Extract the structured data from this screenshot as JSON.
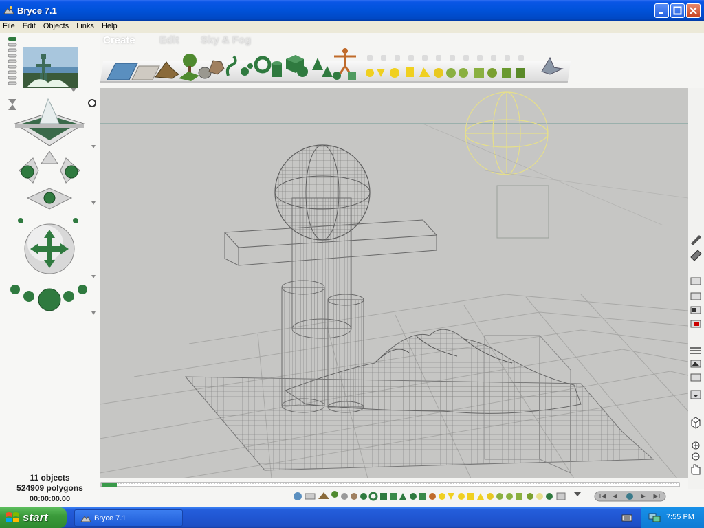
{
  "window": {
    "title": "Bryce 7.1"
  },
  "menu": [
    "File",
    "Edit",
    "Objects",
    "Links",
    "Help"
  ],
  "palette_tabs": {
    "create": "Create",
    "edit": "Edit",
    "sky_fog": "Sky & Fog"
  },
  "stats": {
    "objects": "11 objects",
    "polygons": "524909 polygons",
    "time": "00:00:00.00"
  },
  "taskbar": {
    "start": "start",
    "task": "Bryce 7.1",
    "clock": "7:55 PM"
  },
  "colors": {
    "title_bar": "#0052d9",
    "menu_bar": "#ece9d8",
    "viewport": "#c4c4c4",
    "wireframe": "#6e6e6e",
    "taskbar": "#245edb",
    "accent_green": "#2f7a3f"
  }
}
